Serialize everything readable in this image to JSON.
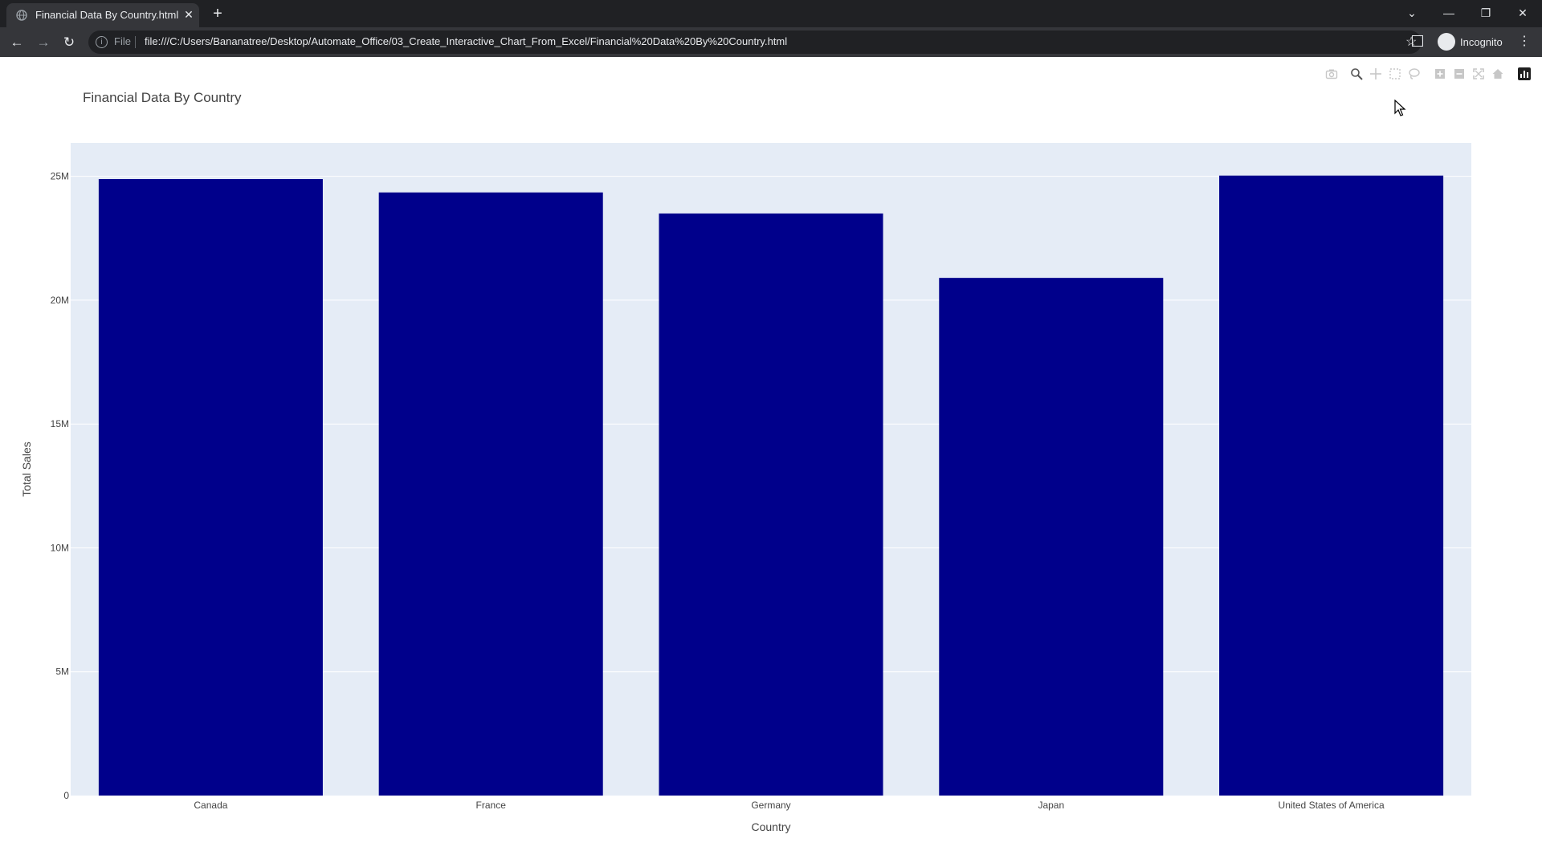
{
  "browser": {
    "tab_title": "Financial Data By Country.html",
    "scheme_label": "File",
    "url": "file:///C:/Users/Bananatree/Desktop/Automate_Office/03_Create_Interactive_Chart_From_Excel/Financial%20Data%20By%20Country.html",
    "incognito_label": "Incognito",
    "icons": [
      "back-arrow-icon",
      "forward-arrow-icon",
      "reload-icon",
      "info-icon",
      "star-icon",
      "side-panel-icon",
      "incognito-icon",
      "menu-icon",
      "minimize-icon",
      "restore-icon",
      "close-icon",
      "new-tab-icon",
      "tab-search-icon"
    ]
  },
  "modebar": {
    "icons": [
      "camera-icon",
      "zoom-icon",
      "pan-icon",
      "box-select-icon",
      "lasso-select-icon",
      "zoom-in-icon",
      "zoom-out-icon",
      "autoscale-icon",
      "reset-axes-icon",
      "plotly-logo-icon"
    ]
  },
  "chart_data": {
    "type": "bar",
    "title": "Financial Data By Country",
    "xlabel": "Country",
    "ylabel": "Total Sales",
    "categories": [
      "Canada",
      "France",
      "Germany",
      "Japan",
      "United States of America"
    ],
    "values": [
      24890000,
      24350000,
      23500000,
      20900000,
      25030000
    ],
    "ylim": [
      0,
      26350000
    ],
    "yticks": [
      0,
      5000000,
      10000000,
      15000000,
      20000000,
      25000000
    ],
    "ytick_labels": [
      "0",
      "5M",
      "10M",
      "15M",
      "20M",
      "25M"
    ],
    "bar_color": "#00008b",
    "plot_bgcolor": "#e5ecf6",
    "grid": true,
    "legend": "none"
  }
}
